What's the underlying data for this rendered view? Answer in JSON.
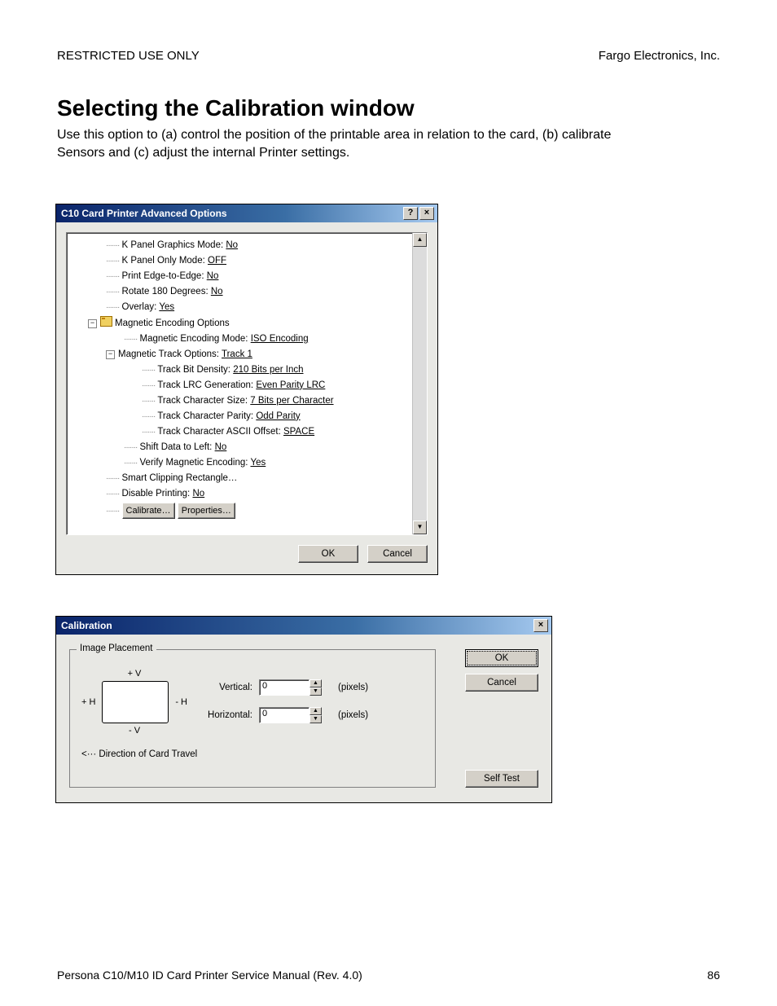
{
  "page_header": {
    "left": "RESTRICTED USE ONLY",
    "right": "Fargo Electronics, Inc."
  },
  "heading": "Selecting the Calibration window",
  "intro": "Use this option to (a) control the position of the printable area in relation to the card, (b) calibrate Sensors and (c) adjust the internal Printer settings.",
  "dialog1": {
    "title": "C10 Card Printer Advanced Options",
    "tree": [
      {
        "indent": 1,
        "label": "K Panel Graphics Mode:",
        "value": "No"
      },
      {
        "indent": 1,
        "label": "K Panel Only Mode:",
        "value": "OFF"
      },
      {
        "indent": 1,
        "label": "Print Edge-to-Edge:",
        "value": "No"
      },
      {
        "indent": 1,
        "label": "Rotate 180 Degrees:",
        "value": "No"
      },
      {
        "indent": 1,
        "label": "Overlay:",
        "value": "Yes"
      },
      {
        "indent": 0,
        "expandable": true,
        "open": true,
        "icon": "folder",
        "label": "Magnetic Encoding Options",
        "value": ""
      },
      {
        "indent": 2,
        "label": "Magnetic Encoding Mode:",
        "value": "ISO Encoding"
      },
      {
        "indent": 1,
        "expandable": true,
        "open": true,
        "label": "Magnetic Track Options:",
        "value": "Track 1"
      },
      {
        "indent": 3,
        "label": "Track Bit Density:",
        "value": "210 Bits per Inch"
      },
      {
        "indent": 3,
        "label": "Track LRC Generation:",
        "value": "Even Parity LRC"
      },
      {
        "indent": 3,
        "label": "Track Character Size:",
        "value": "7 Bits per Character"
      },
      {
        "indent": 3,
        "label": "Track Character Parity:",
        "value": "Odd Parity"
      },
      {
        "indent": 3,
        "label": "Track Character ASCII Offset:",
        "value": "SPACE"
      },
      {
        "indent": 2,
        "label": "Shift Data to Left:",
        "value": "No"
      },
      {
        "indent": 2,
        "label": "Verify Magnetic Encoding:",
        "value": "Yes"
      },
      {
        "indent": 1,
        "label": "Smart Clipping Rectangle…",
        "value": ""
      },
      {
        "indent": 1,
        "label": "Disable Printing:",
        "value": "No"
      }
    ],
    "last_row": {
      "calibrate": "Calibrate…",
      "properties": "Properties…"
    },
    "buttons": {
      "ok": "OK",
      "cancel": "Cancel"
    }
  },
  "dialog2": {
    "title": "Calibration",
    "group": "Image Placement",
    "preview": {
      "plusV": "+ V",
      "plusH": "+ H",
      "minusH": "- H",
      "minusV": "- V"
    },
    "vertical": {
      "label": "Vertical:",
      "value": "0",
      "units": "(pixels)"
    },
    "horizontal": {
      "label": "Horizontal:",
      "value": "0",
      "units": "(pixels)"
    },
    "direction": "<··· Direction of Card Travel",
    "buttons": {
      "ok": "OK",
      "cancel": "Cancel",
      "selftest": "Self Test"
    }
  },
  "page_footer": {
    "left": "Persona C10/M10 ID Card Printer Service Manual (Rev. 4.0)",
    "right": "86"
  }
}
